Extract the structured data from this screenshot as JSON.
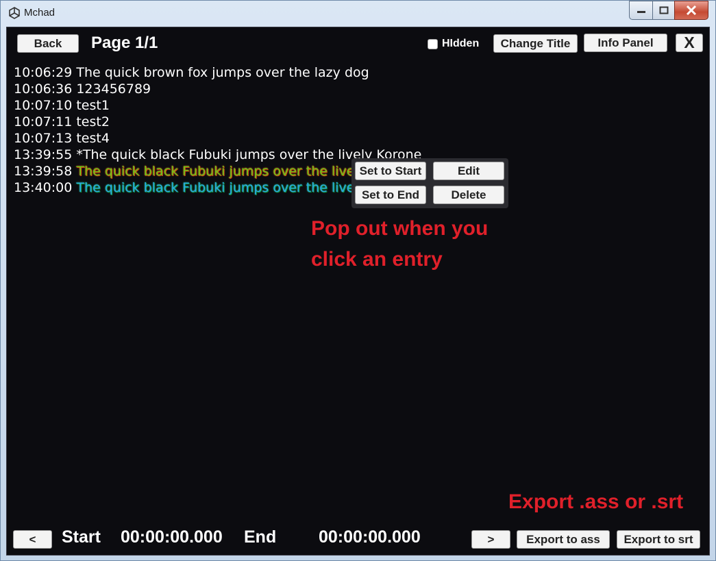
{
  "window": {
    "title": "Mchad",
    "controls": {
      "minimize": "minimize-icon",
      "maximize": "maximize-icon",
      "close": "close-icon"
    }
  },
  "header": {
    "back_label": "Back",
    "page_title": "Page 1/1",
    "hidden_label": "HIdden",
    "hidden_checked": false,
    "change_title_label": "Change Title",
    "info_panel_label": "Info Panel",
    "close_label": "X"
  },
  "entries": [
    {
      "time": "10:06:29",
      "text": "The quick brown fox jumps over the lazy dog",
      "style": "plain"
    },
    {
      "time": "10:06:36",
      "text": "123456789",
      "style": "plain"
    },
    {
      "time": "10:07:10",
      "text": "test1",
      "style": "plain"
    },
    {
      "time": "10:07:11",
      "text": "test2",
      "style": "plain"
    },
    {
      "time": "10:07:13",
      "text": "test4",
      "style": "plain"
    },
    {
      "time": "13:39:55",
      "text": "*The quick black Fubuki jumps over the lively Korone",
      "style": "plain"
    },
    {
      "time": "13:39:58",
      "text": "The quick black Fubuki jumps over the lively",
      "style": "green"
    },
    {
      "time": "13:40:00",
      "text": "The quick black Fubuki jumps over the lively",
      "style": "blue"
    }
  ],
  "popup": {
    "set_to_start": "Set to Start",
    "edit": "Edit",
    "set_to_end": "Set to End",
    "delete": "Delete"
  },
  "annotations": {
    "popup_note_line1": "Pop out when you",
    "popup_note_line2": "click an entry",
    "export_note": "Export .ass or .srt"
  },
  "footer": {
    "prev_label": "<",
    "start_label": "Start",
    "start_time": "00:00:00.000",
    "end_label": "End",
    "end_time": "00:00:00.000",
    "next_label": ">",
    "export_ass_label": "Export to ass",
    "export_srt_label": "Export to srt"
  },
  "colors": {
    "background": "#0c0c10",
    "annotation": "#e0202a",
    "entry_green": "#6cc61a",
    "entry_blue": "#2aa6e6"
  }
}
